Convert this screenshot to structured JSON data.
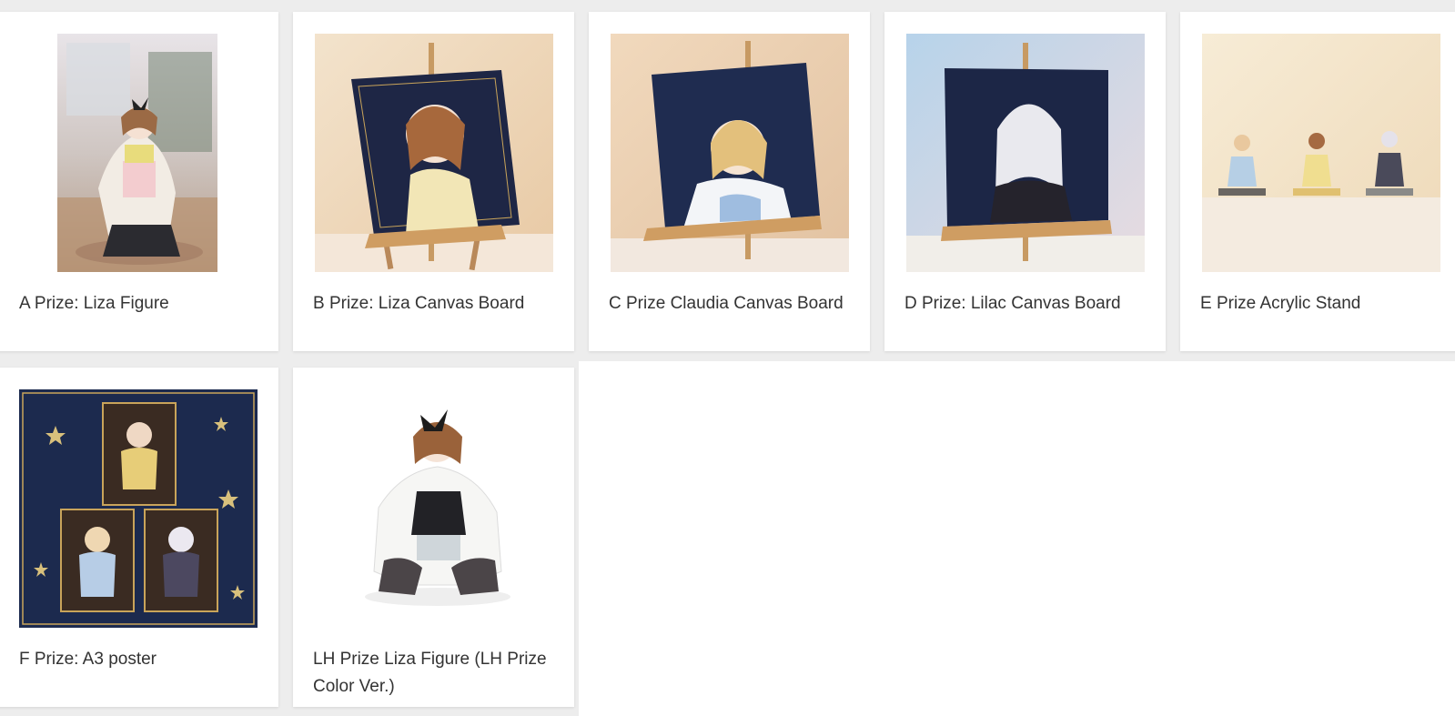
{
  "colors": {
    "page_background": "#ededed",
    "card_background": "#ffffff",
    "label_text": "#333333",
    "poster_navy": "#1c2a4e",
    "gold_accent": "#c9a45a"
  },
  "products": [
    {
      "label": "A Prize: Liza Figure",
      "image": "liza-figure-photo"
    },
    {
      "label": "B Prize: Liza Canvas Board",
      "image": "liza-canvas-board-photo"
    },
    {
      "label": "C Prize Claudia Canvas Board",
      "image": "claudia-canvas-board-photo"
    },
    {
      "label": "D Prize: Lilac Canvas Board",
      "image": "lilac-canvas-board-photo"
    },
    {
      "label": "E Prize Acrylic Stand",
      "image": "acrylic-stand-photo"
    },
    {
      "label": "F Prize: A3 poster",
      "image": "a3-poster-photo"
    },
    {
      "label": "LH Prize Liza Figure (LH Prize Color Ver.)",
      "image": "liza-figure-lh-color-photo"
    }
  ]
}
